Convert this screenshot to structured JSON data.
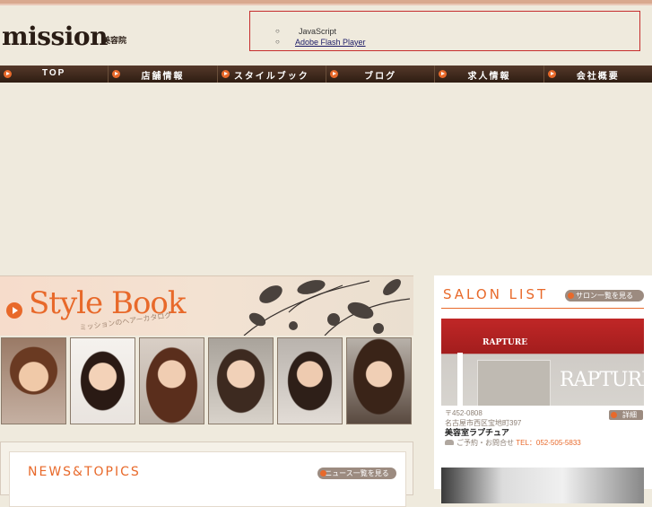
{
  "header": {
    "logo": "mission",
    "logo_sub": "美容院",
    "notice_items": [
      {
        "label": "JavaScript",
        "link": false
      },
      {
        "label": "Adobe Flash Player",
        "link": true
      }
    ]
  },
  "nav": {
    "items": [
      "TOP",
      "店舗情報",
      "スタイルブック",
      "ブログ",
      "求人情報",
      "会社概要"
    ]
  },
  "stylebook": {
    "title": "Style Book",
    "subtitle": "ミッションのヘアーカタログ"
  },
  "news": {
    "title": "NEWS&TOPICS",
    "button": "ニュース一覧を見る"
  },
  "salon": {
    "title": "SALON LIST",
    "button": "サロン一覧を見る",
    "sign_small": "RAPTURE",
    "sign_large": "RAPTURE",
    "detail_button": "詳細",
    "postal": "〒452-0808",
    "address": "名古屋市西区宝地町397",
    "name": "美容室ラプチュア",
    "tel_label": "ご予約・お問合せ",
    "tel": "TEL：052-505-5833"
  },
  "colors": {
    "accent": "#e8692a",
    "nav_bg": "#3a2618",
    "bg": "#efeadd",
    "notice_border": "#c62d2d"
  }
}
